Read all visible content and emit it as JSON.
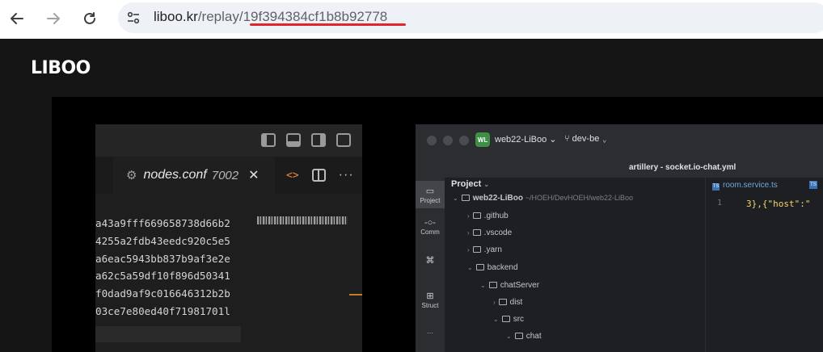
{
  "browser": {
    "url_host": "liboo.kr",
    "url_path": "/replay/",
    "url_id": "19f394384cf1b8b92778",
    "back_icon": "back-arrow-icon",
    "forward_icon": "forward-arrow-icon",
    "reload_icon": "reload-icon",
    "site_info_icon": "site-settings-icon"
  },
  "page": {
    "logo": "LIBOO"
  },
  "editor": {
    "tab_name": "nodes.conf",
    "tab_port": "7002",
    "tab_close": "✕",
    "code_glyph": "<>",
    "more_glyph": "···",
    "hashes": [
      "a43a9fff669658738d66b2",
      "4255a2fdb43eedc920c5e5",
      "a6eac5943bb837b9af3e2e",
      "a62c5a59df10f896d50341",
      "f0dad9af9c016646312b2b",
      "03ce7e80ed40f71981701l"
    ]
  },
  "ide": {
    "project_badge": "WL",
    "project_name": "web22-LiBoo",
    "branch": "dev-be",
    "file_title": "artillery - socket.io-chat.yml",
    "sidebar": [
      {
        "icon": "folder-icon",
        "label": "Project"
      },
      {
        "icon": "commit-icon",
        "label": "Comm"
      },
      {
        "icon": "structure-icon",
        "label": "Struct"
      },
      {
        "icon": "more-icon",
        "label": "···"
      }
    ],
    "tree_header": "Project",
    "tree_root": "web22-LiBoo",
    "tree_root_path": "~/HOEH/DevHOEH/web22-LiBoo",
    "tree_items": [
      {
        "label": ".github",
        "depth": 1
      },
      {
        "label": ".vscode",
        "depth": 1
      },
      {
        "label": ".yarn",
        "depth": 1
      },
      {
        "label": "backend",
        "depth": 1
      },
      {
        "label": "chatServer",
        "depth": 2
      },
      {
        "label": "dist",
        "depth": 3
      },
      {
        "label": "src",
        "depth": 3
      },
      {
        "label": "chat",
        "depth": 4
      }
    ],
    "code_tab": "room.service.ts",
    "line_number": "1",
    "code_text": "3},{\"host\":\""
  }
}
